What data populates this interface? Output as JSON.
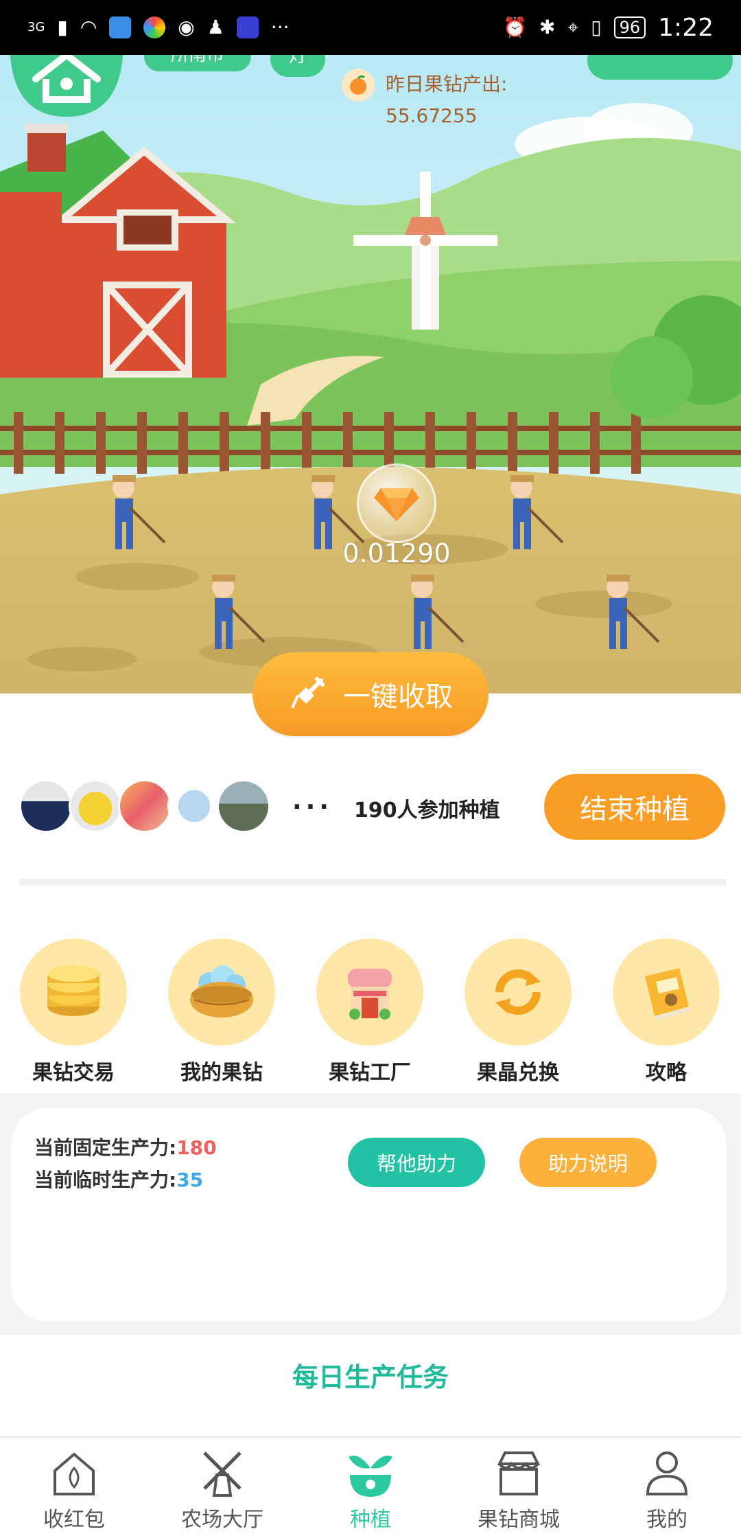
{
  "status_bar": {
    "network": "3G",
    "battery": "96",
    "time": "1:22"
  },
  "farm": {
    "pill_left": "所南市",
    "pill_mid": "灯",
    "yesterday_label": "昨日果钻产出:",
    "yesterday_value": "55.67255",
    "bubble_value": "0.01290",
    "harvest_label": "一键收取"
  },
  "participants": {
    "dots": "···",
    "text": "190人参加种植",
    "end_button": "结束种植"
  },
  "menu": [
    {
      "label": "果钻交易",
      "icon": "gold-coins-icon"
    },
    {
      "label": "我的果钻",
      "icon": "diamond-basket-icon"
    },
    {
      "label": "果钻工厂",
      "icon": "factory-icon"
    },
    {
      "label": "果晶兑换",
      "icon": "exchange-icon"
    },
    {
      "label": "攻略",
      "icon": "album-book-icon"
    }
  ],
  "productivity": {
    "fixed_label": "当前固定生产力:",
    "fixed_value": "180",
    "temp_label": "当前临时生产力:",
    "temp_value": "35",
    "help_button": "帮他助力",
    "explain_button": "助力说明"
  },
  "tasks": {
    "title": "每日生产任务"
  },
  "tabs": [
    {
      "label": "收红包",
      "icon": "red-packet-house-icon",
      "active": false
    },
    {
      "label": "农场大厅",
      "icon": "windmill-icon",
      "active": false
    },
    {
      "label": "种植",
      "icon": "sprout-icon",
      "active": true
    },
    {
      "label": "果钻商城",
      "icon": "shop-icon",
      "active": false
    },
    {
      "label": "我的",
      "icon": "person-icon",
      "active": false
    }
  ],
  "colors": {
    "accent_green": "#2cc8a0",
    "accent_orange": "#f99d25",
    "red_value": "#f35f5f",
    "blue_value": "#3da8e8"
  }
}
